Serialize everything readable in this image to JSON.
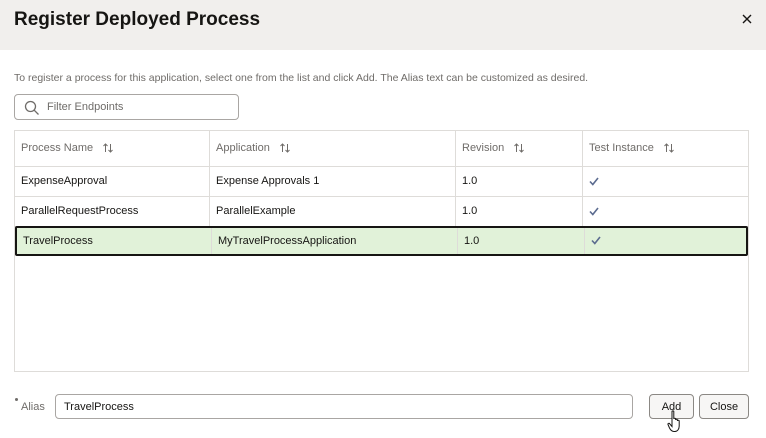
{
  "dialog": {
    "title": "Register Deployed Process",
    "close_icon": "close-icon"
  },
  "instructions": "To register a process for this application, select one from the list and click Add. The Alias text can be customized as desired.",
  "filter": {
    "placeholder": "Filter Endpoints",
    "value": "",
    "icon": "search-icon"
  },
  "table": {
    "columns": [
      "Process Name",
      "Application",
      "Revision",
      "Test Instance"
    ],
    "rows": [
      {
        "process": "ExpenseApproval",
        "application": "Expense Approvals 1",
        "revision": "1.0",
        "test_instance": "✓"
      },
      {
        "process": "ParallelRequestProcess",
        "application": "ParallelExample",
        "revision": "1.0",
        "test_instance": "✓"
      },
      {
        "process": "TravelProcess",
        "application": "MyTravelProcessApplication",
        "revision": "1.0",
        "test_instance": "✓"
      }
    ],
    "selected_row": "TravelProcess"
  },
  "alias": {
    "label": "Alias",
    "value": "TravelProcess"
  },
  "buttons": {
    "add": "Add",
    "close": "Close"
  },
  "colors": {
    "header_bg": "#f1efed",
    "selected_row_bg": "#e1f2d9",
    "check_color": "#5b6b8f"
  }
}
